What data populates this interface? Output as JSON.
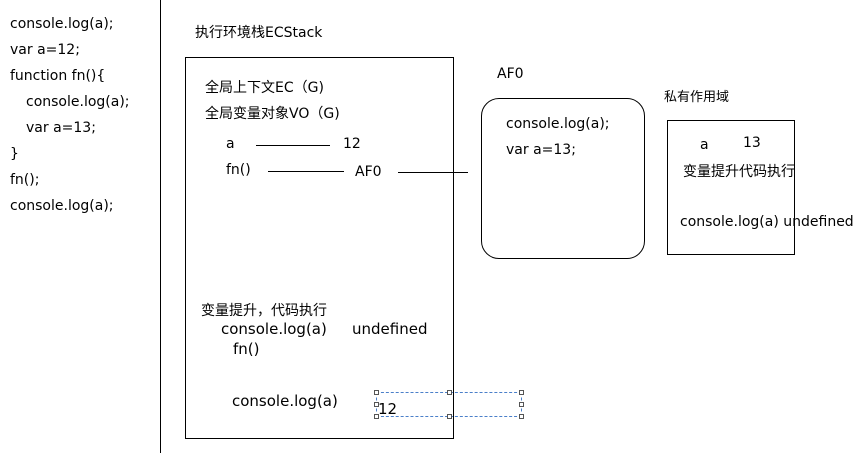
{
  "code_lines": [
    "console.log(a);",
    "var a=12;",
    "function fn(){",
    "console.log(a);",
    "var a=13;",
    "}",
    "fn();",
    "console.log(a);"
  ],
  "ecstack_title": "执行环境栈ECStack",
  "global": {
    "ec_label": "全局上下文EC（G)",
    "vo_label": "全局变量对象VO（G)",
    "var_a": "a",
    "var_a_value": "12",
    "fn_name": "fn()",
    "fn_ref": "AF0",
    "hoist_label": "变量提升，代码执行",
    "log1": "console.log(a)",
    "log1_result": "undefined",
    "call_fn": "fn()",
    "log2": "console.log(a)",
    "log2_result": "12"
  },
  "heap": {
    "title": "AF0",
    "line1": "console.log(a);",
    "line2": "var a=13;"
  },
  "private_scope": {
    "title": "私有作用域",
    "var_a": "a",
    "var_a_value": "13",
    "hoist_label": "变量提升代码执行",
    "log": "console.log(a)",
    "log_result": "undefined"
  }
}
